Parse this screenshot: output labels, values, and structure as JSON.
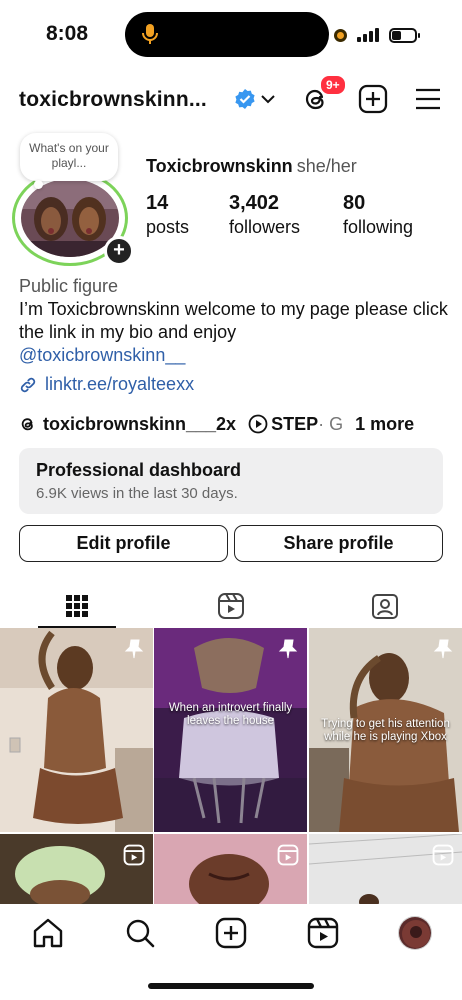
{
  "status_bar": {
    "time": "8:08"
  },
  "header": {
    "username": "toxicbrownskinn...",
    "notification_count": "9+"
  },
  "profile": {
    "note": "What's on your playl...",
    "display_name": "Toxicbrownskinn",
    "pronouns": "she/her",
    "stats": [
      {
        "value": "14",
        "label": "posts"
      },
      {
        "value": "3,402",
        "label": "followers"
      },
      {
        "value": "80",
        "label": "following"
      }
    ],
    "category": "Public figure",
    "bio": "I’m Toxicbrownskinn welcome to my page please click the link in my bio and enjoy",
    "mention": "@toxicbrownskinn__",
    "link": "linktr.ee/royalteexx",
    "threads_handle": "toxicbrownskinn___2x",
    "music_title": "STEP",
    "music_separator": " · G",
    "more_links": "1 more"
  },
  "dashboard": {
    "title": "Professional dashboard",
    "subtitle": "6.9K views in the last 30 days."
  },
  "buttons": {
    "edit": "Edit profile",
    "share": "Share profile"
  },
  "posts": {
    "captions": [
      "When an introvert finally leaves the house",
      "Trying to get his attention while he is playing Xbox"
    ]
  },
  "colors": {
    "link_blue": "#2f5fa8",
    "ring_green": "#7dd35a",
    "badge_red": "#ff3040",
    "verified_blue": "#3897f0"
  },
  "icons": {
    "tabs": [
      "grid-icon",
      "reels-icon",
      "tagged-icon"
    ],
    "nav": [
      "home-icon",
      "search-icon",
      "create-icon",
      "reels-icon",
      "profile-avatar"
    ]
  }
}
